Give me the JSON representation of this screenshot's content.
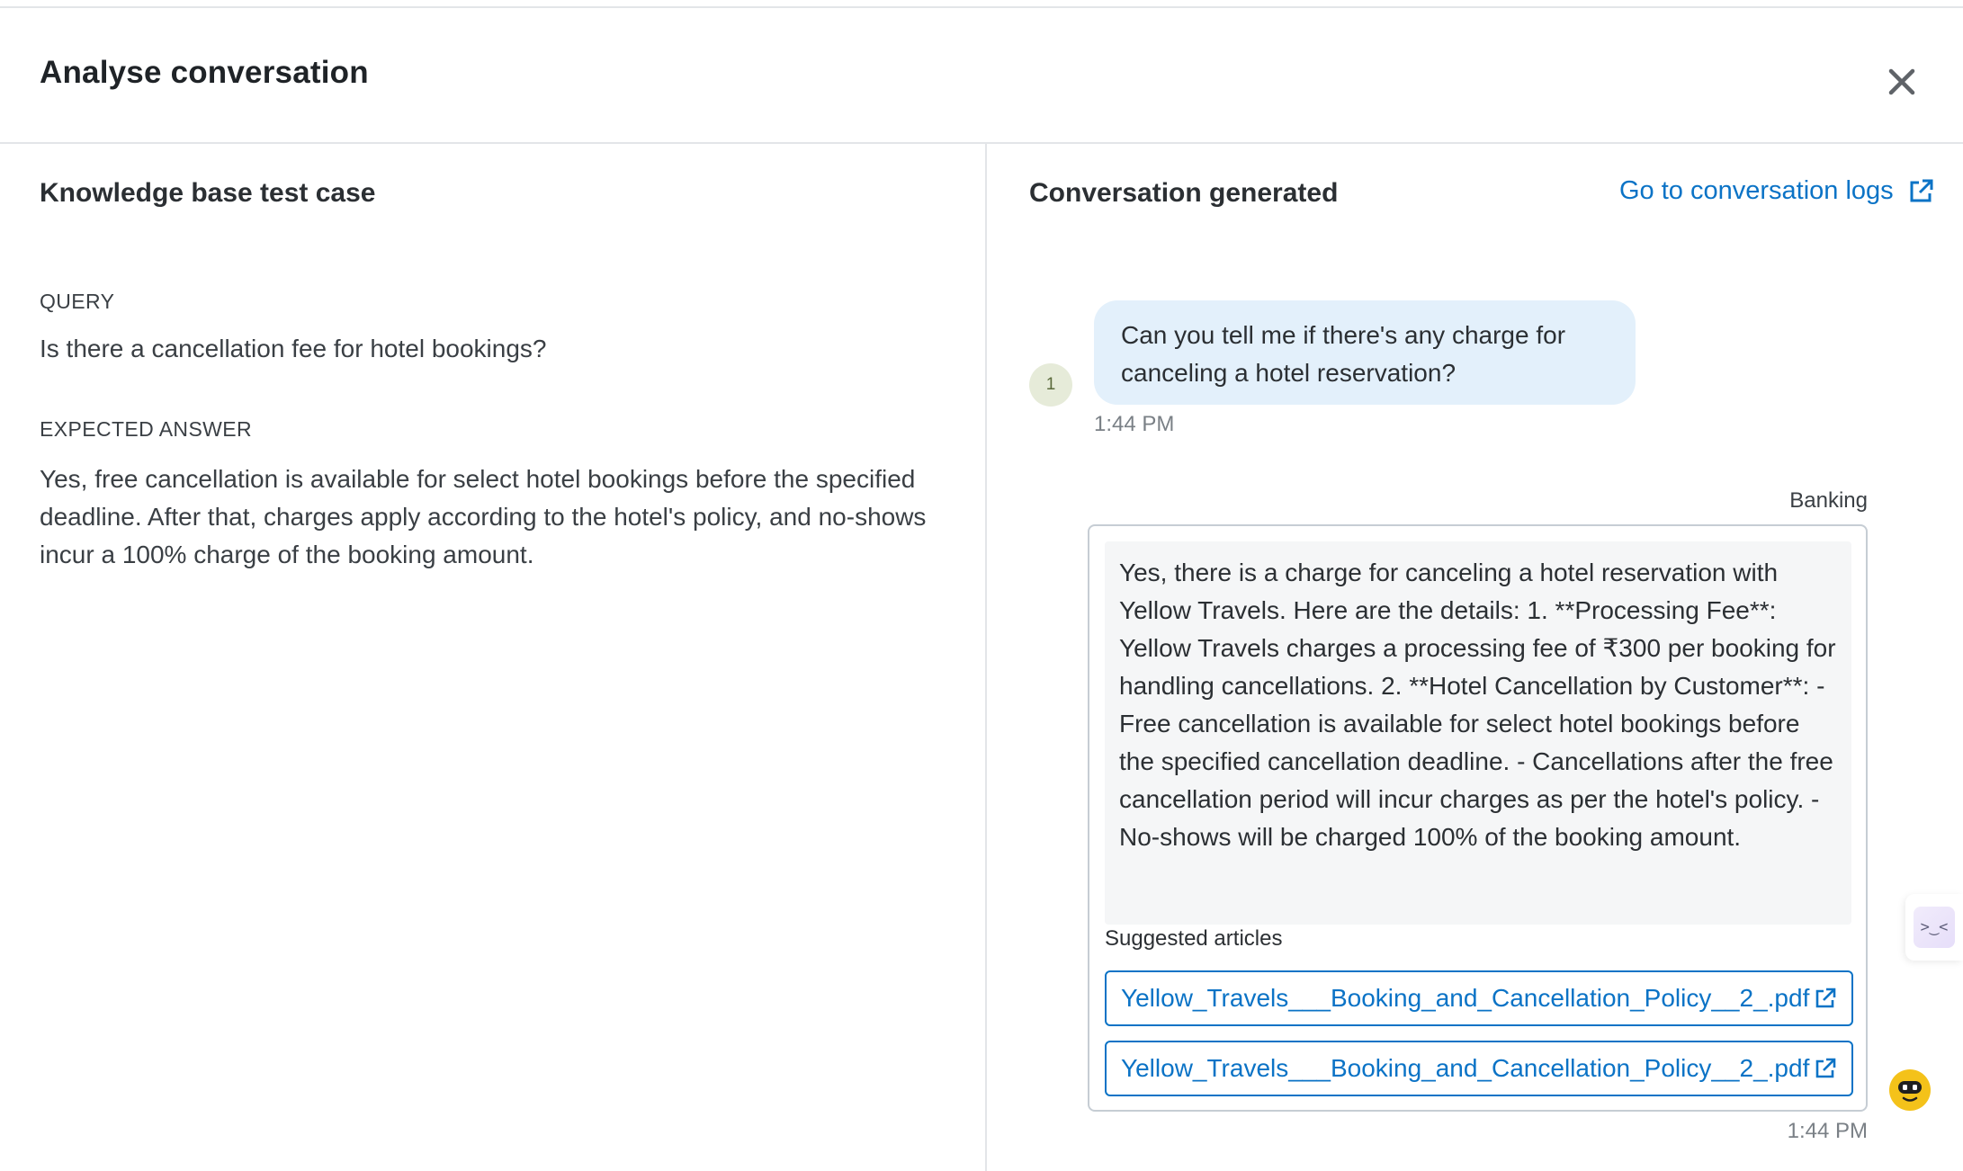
{
  "modal": {
    "title": "Analyse conversation"
  },
  "left_panel": {
    "title": "Knowledge base test case",
    "query_label": "QUERY",
    "query": "Is there a cancellation fee for hotel bookings?",
    "expected_answer_label": "EXPECTED ANSWER",
    "expected_answer": "Yes, free cancellation is available for select hotel bookings before the specified deadline. After that, charges apply according to the hotel's policy, and no-shows incur a 100% charge of the booking amount."
  },
  "right_panel": {
    "title": "Conversation generated",
    "logs_link": "Go to conversation logs",
    "user_message": {
      "avatar_text": "1",
      "text": "Can you tell me if there's any charge for canceling a hotel reservation?",
      "time": "1:44 PM"
    },
    "bot_message": {
      "bot_name": "Banking",
      "text": "Yes, there is a charge for canceling a hotel reservation with Yellow Travels. Here are the details: 1. **Processing Fee**: Yellow Travels charges a processing fee of ₹300 per booking for handling cancellations. 2. **Hotel Cancellation by Customer**: - Free cancellation is available for select hotel bookings before the specified cancellation deadline. - Cancellations after the free cancellation period will incur charges as per the hotel's policy. - No-shows will be charged 100% of the booking amount.",
      "suggested_label": "Suggested articles",
      "articles": [
        "Yellow_Travels___Booking_and_Cancellation_Policy__2_.pdf",
        "Yellow_Travels___Booking_and_Cancellation_Policy__2_.pdf"
      ],
      "time": "1:44 PM"
    }
  },
  "widgets": {
    "side_tab_glyph": ">‿<"
  },
  "colors": {
    "link": "#0b73c6",
    "user_bubble": "#e3f0fb",
    "bot_bubble": "#f5f6f7",
    "border": "#e3e5e8"
  },
  "icons": [
    "close-icon",
    "external-link-icon",
    "assistant-face-icon",
    "bot-avatar-icon"
  ]
}
